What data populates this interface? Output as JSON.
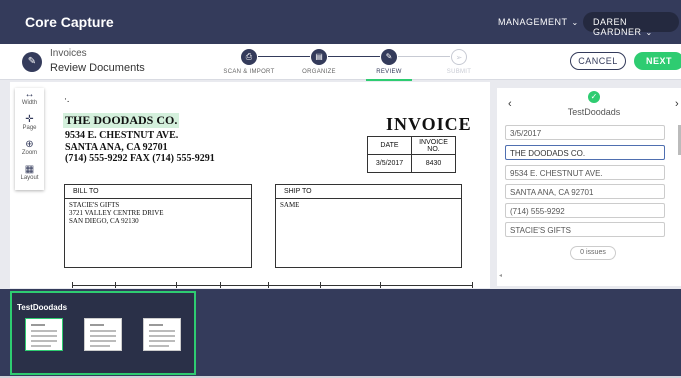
{
  "app": {
    "title": "Core Capture"
  },
  "topbar": {
    "workspace": "MANAGEMENT",
    "user": "DAREN GARDNER"
  },
  "breadcrumb": {
    "section": "Invoices",
    "page": "Review Documents"
  },
  "steps": [
    {
      "label": "SCAN & IMPORT",
      "state": "done"
    },
    {
      "label": "ORGANIZE",
      "state": "done"
    },
    {
      "label": "REVIEW",
      "state": "active"
    },
    {
      "label": "SUBMIT",
      "state": "pending"
    }
  ],
  "actions": {
    "cancel": "CANCEL",
    "next": "NEXT"
  },
  "tools": [
    {
      "icon": "width-icon",
      "glyph": "↔",
      "label": "Width"
    },
    {
      "icon": "page-icon",
      "glyph": "✛",
      "label": "Page"
    },
    {
      "icon": "zoom-icon",
      "glyph": "⊕",
      "label": "Zoom"
    },
    {
      "icon": "layout-icon",
      "glyph": "▦",
      "label": "Layout"
    }
  ],
  "invoice": {
    "vendor": "THE DOODADS CO.",
    "address1": "9534 E. CHESTNUT AVE.",
    "address2": "SANTA ANA, CA 92701",
    "phones": "(714) 555-9292 FAX  (714) 555-9291",
    "title": "INVOICE",
    "date_label": "DATE",
    "invno_label": "INVOICE NO.",
    "date": "3/5/2017",
    "invno": "8430",
    "bill_to_label": "BILL TO",
    "bill_to": [
      "STACIE'S GIFTS",
      "3721 VALLEY CENTRE DRIVE",
      "SAN DIEGO, CA 92130"
    ],
    "ship_to_label": "SHIP TO",
    "ship_to": "SAME"
  },
  "review_panel": {
    "vendor": "TestDoodads",
    "fields": [
      "3/5/2017",
      "THE DOODADS CO.",
      "9534 E. CHESTNUT AVE.",
      "SANTA ANA, CA 92701",
      "(714) 555-9292",
      "STACIE'S GIFTS"
    ],
    "issues": "0 issues"
  },
  "batch": {
    "name": "TestDoodads",
    "thumbnail_count": 3,
    "selected": 0
  },
  "colors": {
    "navy": "#343b5b",
    "accent": "#2ecc71",
    "highlight": "#d4f0dc"
  }
}
